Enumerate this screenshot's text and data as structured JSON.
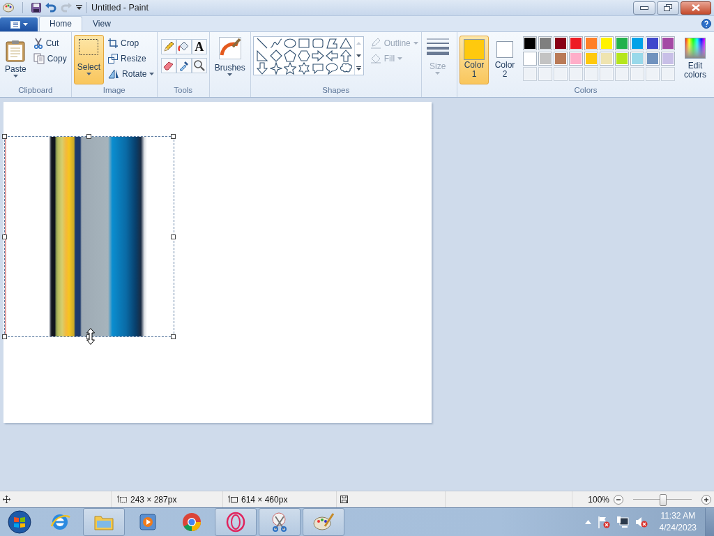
{
  "window": {
    "title": "Untitled - Paint"
  },
  "tabs": [
    {
      "label": "Home",
      "selected": true
    },
    {
      "label": "View",
      "selected": false
    }
  ],
  "ribbon": {
    "clipboard": {
      "label": "Clipboard",
      "paste": "Paste",
      "items": [
        "Cut",
        "Copy"
      ]
    },
    "image": {
      "label": "Image",
      "select": {
        "label": "Select",
        "selected": true
      },
      "items": [
        "Crop",
        "Resize",
        "Rotate"
      ]
    },
    "tools": {
      "label": "Tools",
      "text_tool": "A"
    },
    "brushes": {
      "label": "Brushes"
    },
    "shapes": {
      "label": "Shapes",
      "outline": {
        "label": "Outline",
        "disabled": true
      },
      "fill": {
        "label": "Fill",
        "disabled": true
      }
    },
    "size": {
      "label": "Size",
      "disabled": true
    },
    "colors": {
      "label": "Colors",
      "color1": {
        "label": "Color 1",
        "color": "#ffc90e",
        "selected": true
      },
      "color2": {
        "label": "Color 2",
        "color": "#ffffff",
        "selected": false
      },
      "palette": [
        {
          "color": "#000000"
        },
        {
          "color": "#7f7f7f"
        },
        {
          "color": "#880015"
        },
        {
          "color": "#ed1c24"
        },
        {
          "color": "#ff7f27"
        },
        {
          "color": "#fff200"
        },
        {
          "color": "#22b14c"
        },
        {
          "color": "#00a2e8"
        },
        {
          "color": "#3f48cc"
        },
        {
          "color": "#a349a4"
        },
        {
          "color": "#ffffff"
        },
        {
          "color": "#c3c3c3"
        },
        {
          "color": "#b97a57"
        },
        {
          "color": "#ffaec9"
        },
        {
          "color": "#ffc90e"
        },
        {
          "color": "#efe4b0"
        },
        {
          "color": "#b5e61d"
        },
        {
          "color": "#99d9ea"
        },
        {
          "color": "#7092be"
        },
        {
          "color": "#c8bfe7"
        }
      ],
      "edit_colors": "Edit colors"
    }
  },
  "status_bar": {
    "selection_size": "243 × 287px",
    "canvas_size": "614 × 460px",
    "zoom": "100%",
    "zoom_level": {
      "level": 0.5
    }
  },
  "taskbar": {
    "apps": [
      {
        "kind": "ie",
        "running": false
      },
      {
        "kind": "folder",
        "running": true
      },
      {
        "kind": "media",
        "running": false
      },
      {
        "kind": "chrome",
        "running": false
      },
      {
        "kind": "opera",
        "running": true
      },
      {
        "kind": "snip",
        "running": true
      },
      {
        "kind": "paint",
        "running": true
      }
    ],
    "time": "11:32 AM",
    "date": "4/24/2023"
  }
}
